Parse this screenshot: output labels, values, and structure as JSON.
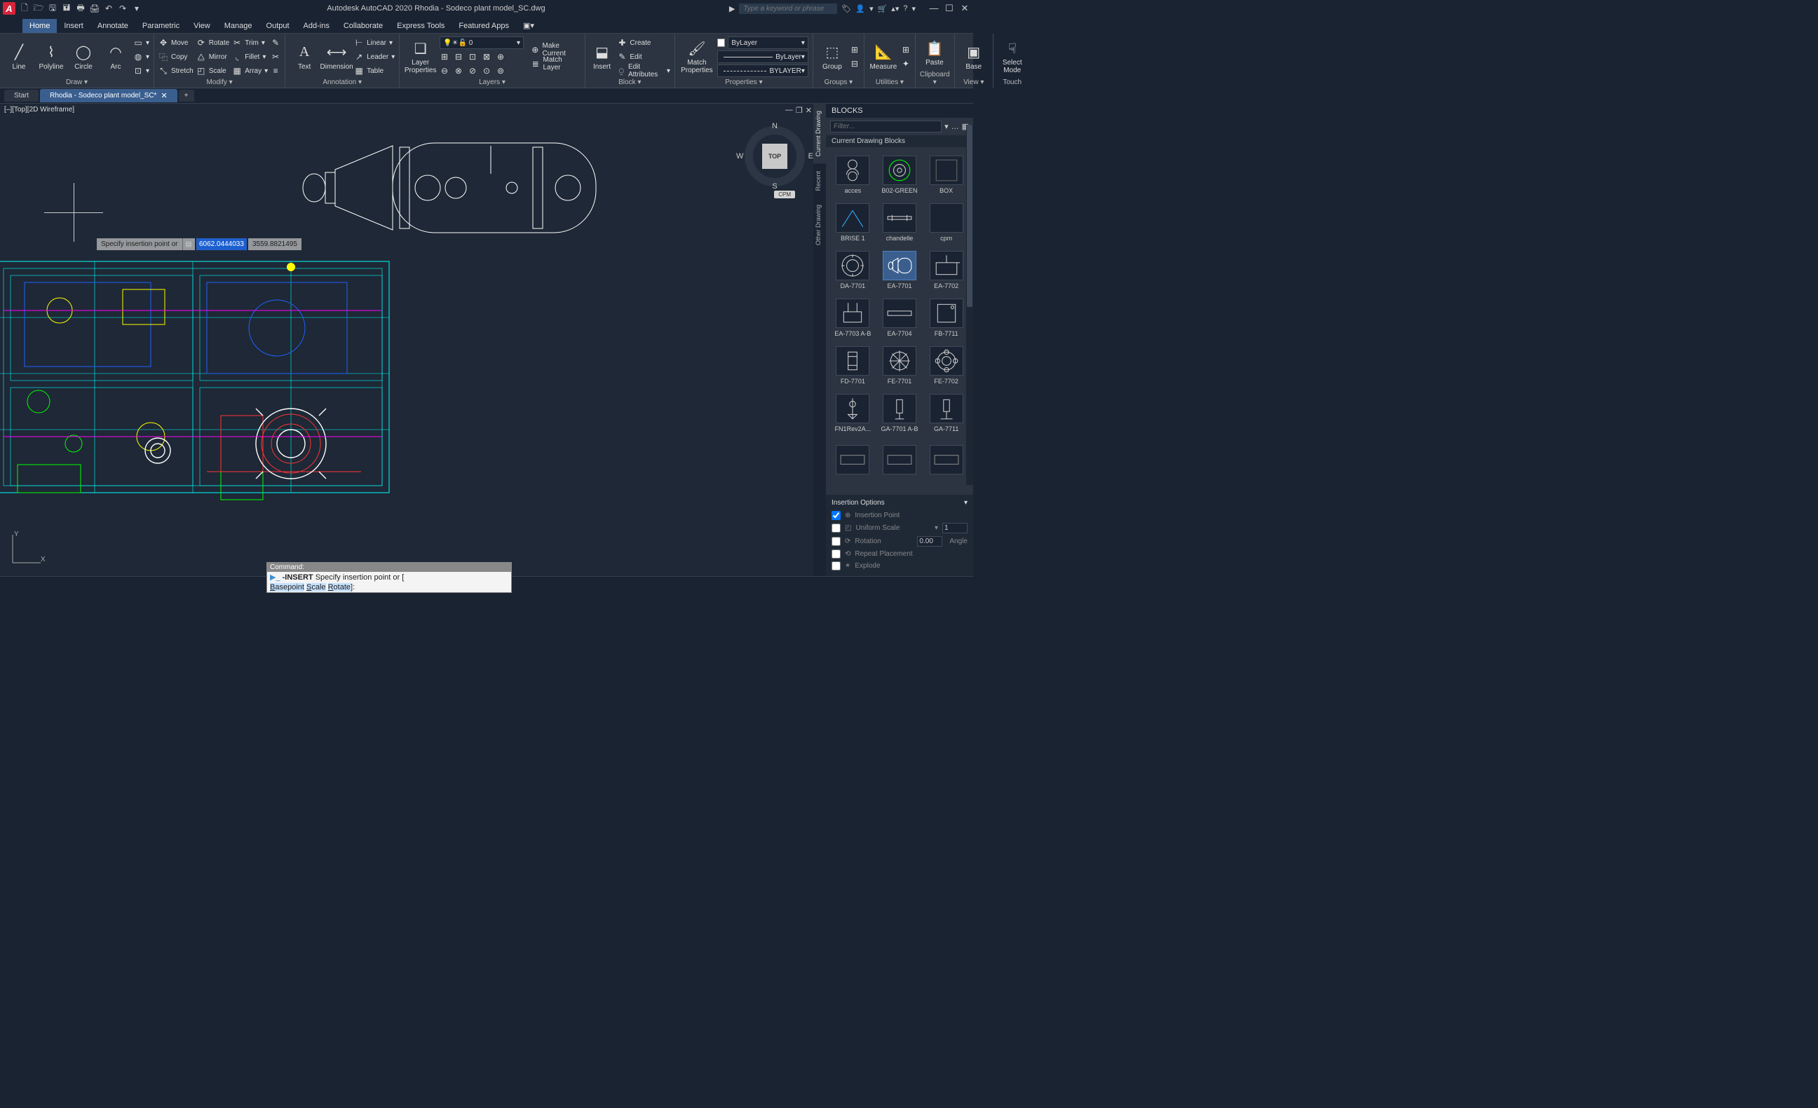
{
  "titlebar": {
    "app_letter": "A",
    "title": "Autodesk AutoCAD 2020    Rhodia - Sodeco plant model_SC.dwg",
    "search_ph": "Type a keyword or phrase"
  },
  "menu": {
    "tabs": [
      "Home",
      "Insert",
      "Annotate",
      "Parametric",
      "View",
      "Manage",
      "Output",
      "Add-ins",
      "Collaborate",
      "Express Tools",
      "Featured Apps"
    ]
  },
  "ribbon": {
    "draw": {
      "label": "Draw ▾",
      "line": "Line",
      "polyline": "Polyline",
      "circle": "Circle",
      "arc": "Arc"
    },
    "modify": {
      "label": "Modify ▾",
      "move": "Move",
      "copy": "Copy",
      "stretch": "Stretch",
      "rotate": "Rotate",
      "mirror": "Mirror",
      "scale": "Scale",
      "trim": "Trim",
      "fillet": "Fillet",
      "array": "Array"
    },
    "annot": {
      "label": "Annotation ▾",
      "text": "Text",
      "dim": "Dimension",
      "linear": "Linear",
      "leader": "Leader",
      "table": "Table"
    },
    "layers": {
      "label": "Layers ▾",
      "props": "Layer\nProperties",
      "dd": "0"
    },
    "layerops": {
      "create": "Create",
      "edit": "Edit",
      "editattr": "Edit Attributes",
      "makecurrent": "Make Current",
      "matchlayer": "Match Layer",
      "insert": "Insert"
    },
    "block": {
      "label": "Block ▾",
      "match": "Match\nProperties"
    },
    "props": {
      "label": "Properties ▾",
      "bylayer": "ByLayer",
      "bylayer2": "ByLayer",
      "bylayer3": "BYLAYER"
    },
    "groups": {
      "label": "Groups ▾",
      "group": "Group"
    },
    "utils": {
      "label": "Utilities ▾",
      "measure": "Measure"
    },
    "clip": {
      "label": "Clipboard ▾",
      "paste": "Paste"
    },
    "view": {
      "label": "View ▾",
      "base": "Base"
    },
    "touch": {
      "label": "Touch",
      "sel": "Select\nMode"
    }
  },
  "filetabs": {
    "start": "Start",
    "file": "Rhodia - Sodeco plant model_SC*",
    "plus": "+"
  },
  "viewport": {
    "label": "[–][Top][2D Wireframe]",
    "cubeface": "TOP",
    "n": "N",
    "s": "S",
    "e": "E",
    "w": "W",
    "cpm": "CPM",
    "tooltip_label": "Specify insertion point or",
    "coord1": "6062.0444033",
    "coord2": "3559.8821495",
    "ucs_y": "Y",
    "ucs_x": "X"
  },
  "blocks": {
    "title": "BLOCKS",
    "filter_ph": "Filter...",
    "subhdr": "Current Drawing Blocks",
    "tabs": [
      "Current Drawing",
      "Recent",
      "Other Drawing"
    ],
    "items": [
      {
        "n": "acces"
      },
      {
        "n": "B02-GREEN"
      },
      {
        "n": "BOX"
      },
      {
        "n": "BRISE 1"
      },
      {
        "n": "chandelle"
      },
      {
        "n": "cpm"
      },
      {
        "n": "DA-7701"
      },
      {
        "n": "EA-7701",
        "sel": true
      },
      {
        "n": "EA-7702"
      },
      {
        "n": "EA-7703 A-B"
      },
      {
        "n": "EA-7704"
      },
      {
        "n": "FB-7711"
      },
      {
        "n": "FD-7701"
      },
      {
        "n": "FE-7701"
      },
      {
        "n": "FE-7702"
      },
      {
        "n": "FN1Rev2A..."
      },
      {
        "n": "GA-7701 A-B"
      },
      {
        "n": "GA-7711"
      },
      {
        "n": ""
      },
      {
        "n": ""
      },
      {
        "n": ""
      }
    ],
    "ins": {
      "hdr": "Insertion Options",
      "pt": "Insertion Point",
      "us": "Uniform Scale",
      "us_v": "1",
      "rot": "Rotation",
      "rot_v": "0.00",
      "ang": "Angle",
      "rp": "Repeat Placement",
      "exp": "Explode"
    }
  },
  "cmd": {
    "hdr": "Command:",
    "l1a": "-INSERT ",
    "l1b": "Specify insertion point or [",
    "l2": "Basepoint Scale Rotate]:",
    "hB": "B",
    "hS": "S",
    "hR": "R"
  }
}
